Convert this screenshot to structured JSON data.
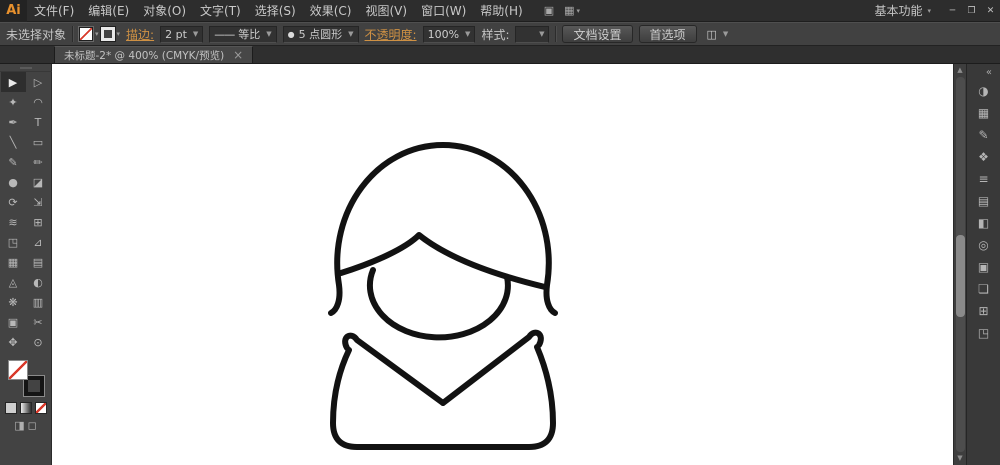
{
  "colors": {
    "accent_orange": "#e8912d",
    "link_orange": "#cf9144",
    "none_slash_red": "#d93a2b",
    "ui_dark": "#2d2d2d",
    "ui_mid": "#414141",
    "canvas_white": "#ffffff"
  },
  "glyphs": {
    "dropdown_arrow": "▼",
    "small_arrow": "▾",
    "scroll_up": "▲",
    "scroll_down": "▼",
    "profile_line": "——",
    "brush_dot": "●"
  },
  "menu_bar": {
    "logo": "Ai",
    "items": [
      "文件(F)",
      "编辑(E)",
      "对象(O)",
      "文字(T)",
      "选择(S)",
      "效果(C)",
      "视图(V)",
      "窗口(W)",
      "帮助(H)"
    ],
    "icons": [
      {
        "name": "bridge",
        "glyph": "▣"
      },
      {
        "name": "arrange-documents",
        "glyph": "▦"
      }
    ],
    "workspace_switcher": "基本功能",
    "window_controls": {
      "minimize": "─",
      "restore": "❐",
      "close": "✕"
    }
  },
  "control_bar": {
    "selection_status": "未选择对象",
    "stroke_link": "描边:",
    "stroke_weight_value": "2 pt",
    "width_profile_value": "等比",
    "brush_definition_value": "5 点圆形",
    "opacity_link": "不透明度:",
    "opacity_value": "100%",
    "style_label": "样式:",
    "document_setup_button": "文档设置",
    "preferences_button": "首选项",
    "panel_menu_icon": "◫"
  },
  "tab_bar": {
    "document_title": "未标题-2* @ 400% (CMYK/预览)",
    "close_icon": "×"
  },
  "toolbar": {
    "tools": [
      {
        "name": "selection",
        "glyph": "▶"
      },
      {
        "name": "direct-selection",
        "glyph": "▷"
      },
      {
        "name": "magic-wand",
        "glyph": "✦"
      },
      {
        "name": "lasso",
        "glyph": "◠"
      },
      {
        "name": "pen",
        "glyph": "✒"
      },
      {
        "name": "type",
        "glyph": "T"
      },
      {
        "name": "line-segment",
        "glyph": "╲"
      },
      {
        "name": "rectangle",
        "glyph": "▭"
      },
      {
        "name": "paintbrush",
        "glyph": "✎"
      },
      {
        "name": "pencil",
        "glyph": "✏"
      },
      {
        "name": "blob-brush",
        "glyph": "●"
      },
      {
        "name": "eraser",
        "glyph": "◪"
      },
      {
        "name": "rotate",
        "glyph": "⟳"
      },
      {
        "name": "scale",
        "glyph": "⇲"
      },
      {
        "name": "width",
        "glyph": "≋"
      },
      {
        "name": "free-transform",
        "glyph": "⊞"
      },
      {
        "name": "shape-builder",
        "glyph": "◳"
      },
      {
        "name": "perspective-grid",
        "glyph": "⊿"
      },
      {
        "name": "mesh",
        "glyph": "▦"
      },
      {
        "name": "gradient",
        "glyph": "▤"
      },
      {
        "name": "eyedropper",
        "glyph": "◬"
      },
      {
        "name": "blend",
        "glyph": "◐"
      },
      {
        "name": "symbol-sprayer",
        "glyph": "❋"
      },
      {
        "name": "column-graph",
        "glyph": "▥"
      },
      {
        "name": "artboard",
        "glyph": "▣"
      },
      {
        "name": "slice",
        "glyph": "✂"
      },
      {
        "name": "hand",
        "glyph": "✥"
      },
      {
        "name": "zoom",
        "glyph": "⊙"
      }
    ],
    "mode_icons": [
      "◨",
      "◻"
    ]
  },
  "right_dock": {
    "collapse_icon": "«",
    "panels": [
      {
        "name": "color",
        "glyph": "◑"
      },
      {
        "name": "swatches",
        "glyph": "▦"
      },
      {
        "name": "brushes",
        "glyph": "✎"
      },
      {
        "name": "symbols",
        "glyph": "❖"
      },
      {
        "name": "stroke",
        "glyph": "≡"
      },
      {
        "name": "gradient",
        "glyph": "▤"
      },
      {
        "name": "transparency",
        "glyph": "◧"
      },
      {
        "name": "appearance",
        "glyph": "◎"
      },
      {
        "name": "graphic-styles",
        "glyph": "▣"
      },
      {
        "name": "layers",
        "glyph": "❏"
      },
      {
        "name": "align",
        "glyph": "⊞"
      },
      {
        "name": "pathfinder",
        "glyph": "◳"
      }
    ]
  },
  "canvas": {
    "background": "#ffffff",
    "stroke_color": "#121212",
    "artwork_description": "黑色粗描边线稿：蘑菇头发型人物头像（刘海、脸部圆弧、V 形衣领与肩部）"
  }
}
